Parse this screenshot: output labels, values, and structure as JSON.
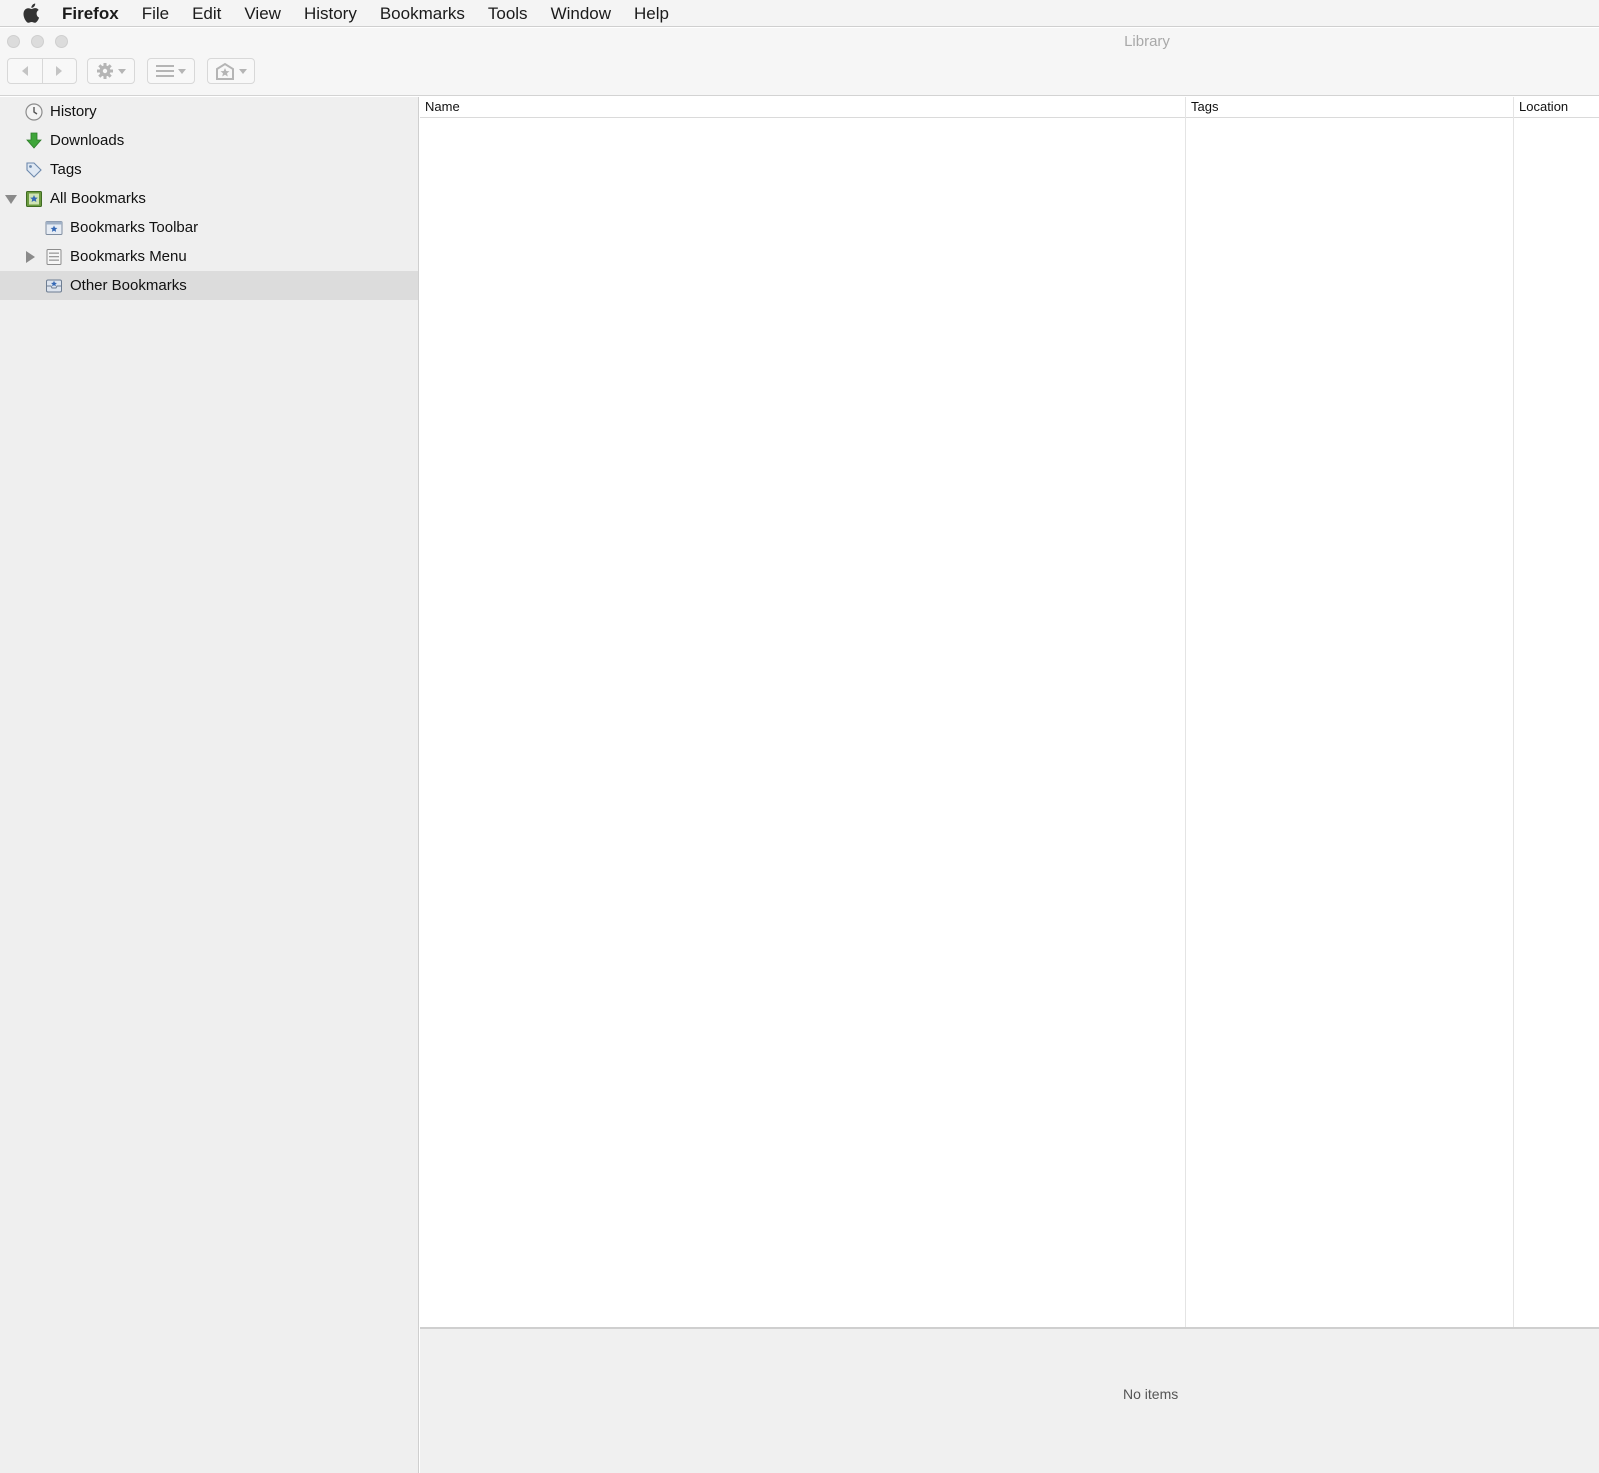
{
  "menubar": {
    "app_name": "Firefox",
    "items": [
      "File",
      "Edit",
      "View",
      "History",
      "Bookmarks",
      "Tools",
      "Window",
      "Help"
    ]
  },
  "window": {
    "title": "Library"
  },
  "toolbar": {
    "back_icon": "back-arrow-icon",
    "forward_icon": "forward-arrow-icon",
    "organize_icon": "gear-icon",
    "views_icon": "list-icon",
    "import_backup_icon": "star-import-icon"
  },
  "sidebar": {
    "items": [
      {
        "label": "History",
        "icon": "clock-icon"
      },
      {
        "label": "Downloads",
        "icon": "download-arrow-icon"
      },
      {
        "label": "Tags",
        "icon": "tag-icon"
      },
      {
        "label": "All Bookmarks",
        "icon": "bookmarks-library-icon",
        "expanded": true
      },
      {
        "label": "Bookmarks Toolbar",
        "icon": "bookmarks-toolbar-icon"
      },
      {
        "label": "Bookmarks Menu",
        "icon": "bookmarks-menu-icon",
        "expanded": false
      },
      {
        "label": "Other Bookmarks",
        "icon": "unsorted-bookmarks-icon",
        "selected": true
      }
    ]
  },
  "main": {
    "columns": [
      "Name",
      "Tags",
      "Location"
    ],
    "status": "No items"
  },
  "colors": {
    "sidebar_bg": "#efefef",
    "selected_row": "#dcdcdc",
    "details_bg": "#f0f0f0"
  }
}
